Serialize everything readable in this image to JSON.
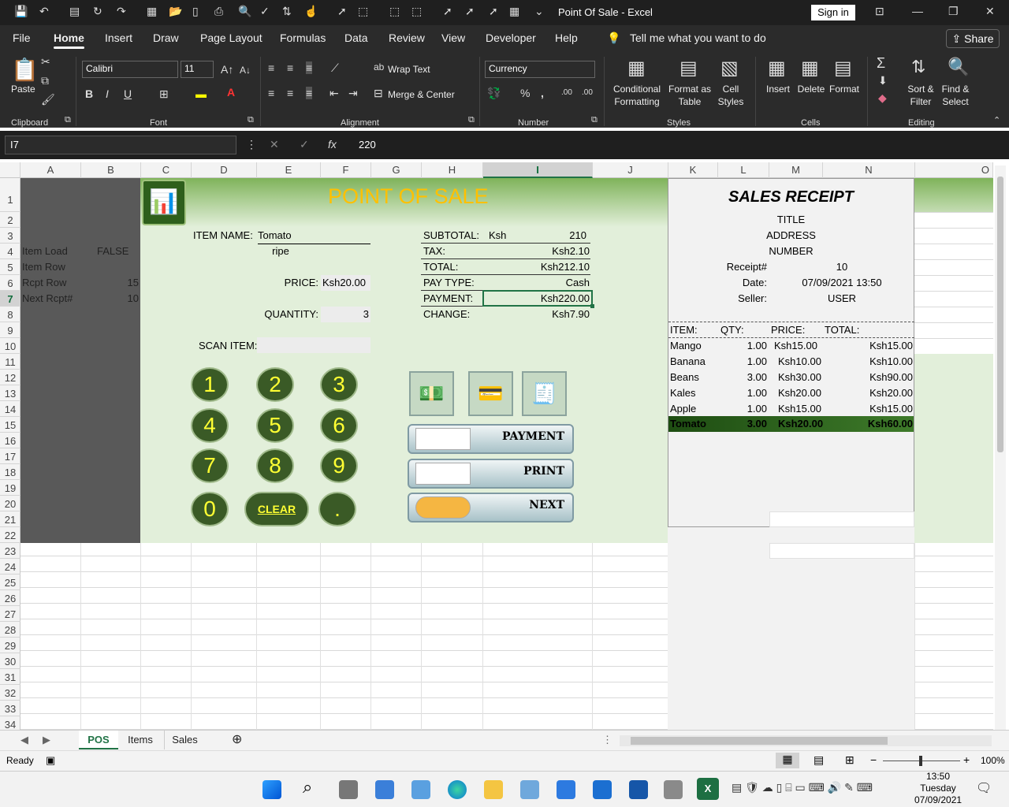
{
  "window": {
    "title": "Point Of Sale  -  Excel",
    "sign_in": "Sign in"
  },
  "ribbon_tabs": [
    "File",
    "Home",
    "Insert",
    "Draw",
    "Page Layout",
    "Formulas",
    "Data",
    "Review",
    "View",
    "Developer",
    "Help"
  ],
  "tell_me": "Tell me what you want to do",
  "share": "Share",
  "ribbon": {
    "paste": "Paste",
    "font_name": "Calibri",
    "font_size": "11",
    "wrap_text": "Wrap Text",
    "merge_center": "Merge & Center",
    "number_format": "Currency",
    "conditional_formatting": [
      "Conditional",
      "Formatting"
    ],
    "format_as_table": [
      "Format as",
      "Table"
    ],
    "cell_styles": [
      "Cell",
      "Styles"
    ],
    "insert": "Insert",
    "delete": "Delete",
    "format": "Format",
    "sort_filter": [
      "Sort &",
      "Filter"
    ],
    "find_select": [
      "Find &",
      "Select"
    ],
    "groups": [
      "Clipboard",
      "Font",
      "Alignment",
      "Number",
      "Styles",
      "Cells",
      "Editing"
    ]
  },
  "formula_bar": {
    "name_box": "I7",
    "value": "220"
  },
  "columns": [
    "A",
    "B",
    "C",
    "D",
    "E",
    "F",
    "G",
    "H",
    "I",
    "J",
    "K",
    "L",
    "M",
    "N",
    "O"
  ],
  "rows": [
    "1",
    "2",
    "3",
    "4",
    "5",
    "6",
    "7",
    "8",
    "9",
    "10",
    "11",
    "12",
    "13",
    "14",
    "15",
    "16",
    "17",
    "18",
    "19",
    "20",
    "21",
    "22",
    "23",
    "24",
    "25",
    "26",
    "27",
    "28",
    "29",
    "30",
    "31",
    "32",
    "33",
    "34"
  ],
  "sidebar": [
    {
      "label": "Item Load",
      "value": "FALSE"
    },
    {
      "label": "Item Row",
      "value": ""
    },
    {
      "label": "Rcpt Row",
      "value": "15"
    },
    {
      "label": "Next Rcpt#",
      "value": "10"
    }
  ],
  "pos": {
    "title": "POINT OF SALE",
    "item_name_label": "ITEM NAME:",
    "item_name": "Tomato",
    "item_desc": "ripe",
    "price_label": "PRICE:",
    "price": "Ksh20.00",
    "quantity_label": "QUANTITY:",
    "quantity": "3",
    "scan_label": "SCAN ITEM:",
    "keypad": [
      "1",
      "2",
      "3",
      "4",
      "5",
      "6",
      "7",
      "8",
      "9",
      "0",
      "CLEAR",
      "."
    ],
    "subtotal_label": "SUBTOTAL:",
    "subtotal_currency": "Ksh",
    "subtotal": "210",
    "tax_label": "TAX:",
    "tax": "Ksh2.10",
    "total_label": "TOTAL:",
    "total": "Ksh212.10",
    "pay_type_label": "PAY TYPE:",
    "pay_type": "Cash",
    "payment_label": "PAYMENT:",
    "payment": "Ksh220.00",
    "change_label": "CHANGE:",
    "change": "Ksh7.90",
    "buttons": [
      "PAYMENT",
      "PRINT",
      "NEXT"
    ]
  },
  "receipt": {
    "title": "SALES RECEIPT",
    "header_lines": [
      "TITLE",
      "ADDRESS",
      "NUMBER"
    ],
    "receipt_label": "Receipt#",
    "receipt_no": "10",
    "date_label": "Date:",
    "date": "07/09/2021 13:50",
    "seller_label": "Seller:",
    "seller": "USER",
    "columns": [
      "ITEM:",
      "QTY:",
      "PRICE:",
      "TOTAL:"
    ],
    "items": [
      {
        "item": "Mango",
        "qty": "1.00",
        "price": "Ksh15.00",
        "total": "Ksh15.00"
      },
      {
        "item": "Banana",
        "qty": "1.00",
        "price": "Ksh10.00",
        "total": "Ksh10.00"
      },
      {
        "item": "Beans",
        "qty": "3.00",
        "price": "Ksh30.00",
        "total": "Ksh90.00"
      },
      {
        "item": "Kales",
        "qty": "1.00",
        "price": "Ksh20.00",
        "total": "Ksh20.00"
      },
      {
        "item": "Apple",
        "qty": "1.00",
        "price": "Ksh15.00",
        "total": "Ksh15.00"
      },
      {
        "item": "Tomato",
        "qty": "3.00",
        "price": "Ksh20.00",
        "total": "Ksh60.00"
      }
    ]
  },
  "sheets": [
    "POS",
    "Items",
    "Sales"
  ],
  "status": {
    "ready": "Ready",
    "zoom": "100%"
  },
  "taskbar": {
    "time": "13:50",
    "day": "Tuesday",
    "date": "07/09/2021"
  },
  "colors": {
    "excel_green": "#217346",
    "pos_green": "#e2efda",
    "header_green": "#8fbc6a",
    "dark_green": "#2e5f1c",
    "title_yellow": "#ffc000",
    "sidebar_gray": "#595959"
  }
}
